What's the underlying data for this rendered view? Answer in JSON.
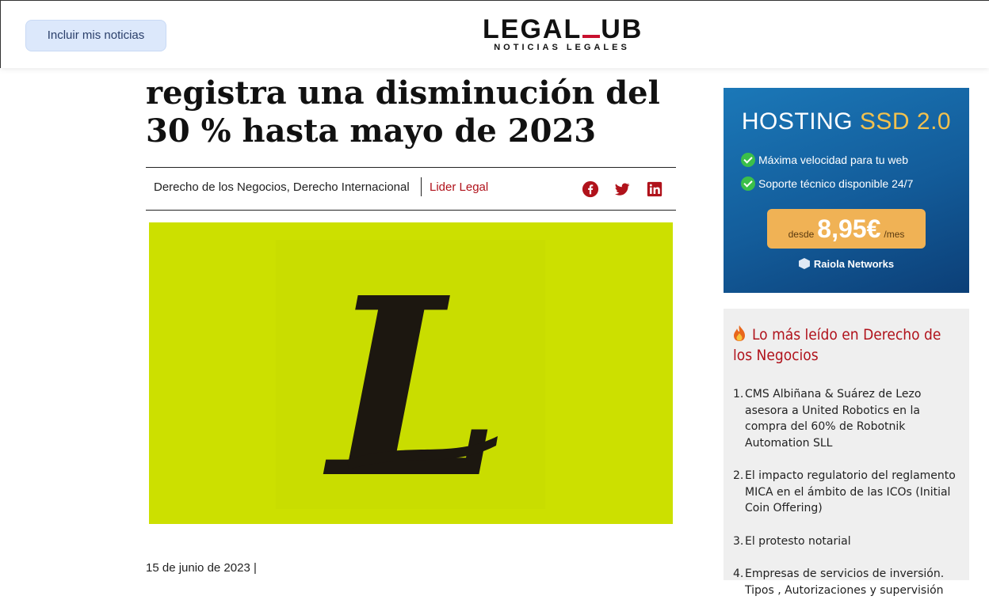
{
  "header": {
    "include_button": "Incluir mis noticias",
    "logo_left": "LEGAL",
    "logo_right": "UB",
    "logo_tagline": "NOTICIAS LEGALES"
  },
  "article": {
    "headline": "registra una disminución del 30 % hasta mayo de 2023",
    "categories": "Derecho de los Negocios, Derecho Internacional",
    "author": "Lider Legal",
    "date": "15 de junio de 2023 |",
    "hero_letter": "L"
  },
  "share_icons": [
    "facebook-icon",
    "twitter-icon",
    "linkedin-icon"
  ],
  "ad": {
    "title_main": "HOSTING ",
    "title_accent": "SSD 2.0",
    "features": [
      "Máxima velocidad para tu web",
      "Soporte técnico disponible 24/7"
    ],
    "price_from": "desde",
    "price": "8,95€",
    "price_per": "/mes",
    "brand": "Raiola Networks"
  },
  "sidebar": {
    "title": "Lo más leído en Derecho de los Negocios",
    "items": [
      {
        "num": "1.",
        "text": "CMS Albiñana & Suárez de Lezo asesora a United Robotics en la compra del 60% de Robotnik Automation SLL"
      },
      {
        "num": "2.",
        "text": "El impacto regulatorio del reglamento MICA en el ámbito de las ICOs (Initial Coin Offering)"
      },
      {
        "num": "3.",
        "text": "El protesto notarial"
      },
      {
        "num": "4.",
        "text": "Empresas de servicios de inversión. Tipos , Autorizaciones y supervisión"
      }
    ]
  },
  "colors": {
    "accent_red": "#b0121b",
    "hero_bg": "#cce000",
    "button_bg": "#dce8fb"
  }
}
